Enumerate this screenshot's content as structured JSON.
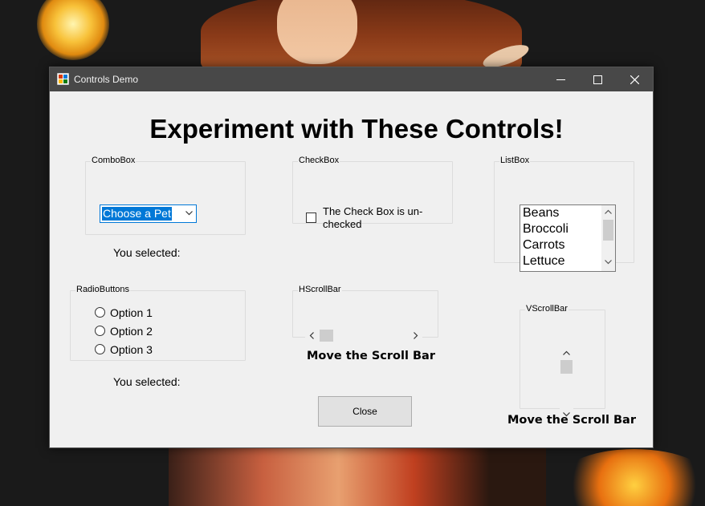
{
  "window": {
    "title": "Controls Demo"
  },
  "heading": "Experiment with These Controls!",
  "combobox": {
    "group_label": "ComboBox",
    "selected_text": "Choose a Pet",
    "result_label": "You selected:"
  },
  "checkbox": {
    "group_label": "CheckBox",
    "label": "The Check Box is un-checked",
    "checked": false
  },
  "listbox": {
    "group_label": "ListBox",
    "items": [
      "Beans",
      "Broccoli",
      "Carrots",
      "Lettuce"
    ]
  },
  "radiobuttons": {
    "group_label": "RadioButtons",
    "options": [
      "Option 1",
      "Option 2",
      "Option 3"
    ],
    "result_label": "You selected:"
  },
  "hscrollbar": {
    "group_label": "HScrollBar",
    "caption": "Move the Scroll Bar"
  },
  "vscrollbar": {
    "group_label": "VScrollBar",
    "caption": "Move the Scroll Bar"
  },
  "close_button": "Close",
  "colors": {
    "titlebar": "#484848",
    "window_bg": "#f0f0f0",
    "selection": "#0078d7"
  }
}
